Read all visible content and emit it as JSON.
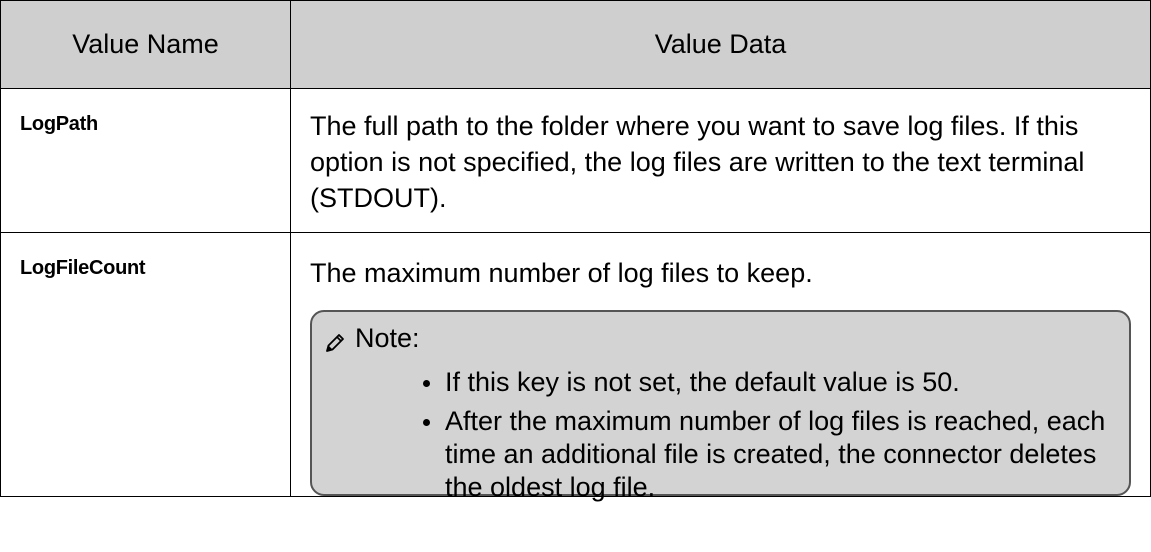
{
  "table": {
    "headers": {
      "name": "Value Name",
      "data": "Value Data"
    },
    "rows": [
      {
        "name": "LogPath",
        "data": "The full path to the folder where you want to save log files. If this option is not specified, the log files are written to the text terminal (STDOUT)."
      },
      {
        "name": "LogFileCount",
        "data": "The maximum number of log files to keep.",
        "note": {
          "icon": "pencil-icon",
          "label": "Note:",
          "items": [
            "If this key is not set, the default value is 50.",
            "After the maximum number of log files is reached, each time an additional file is created, the connector deletes the oldest log file."
          ]
        }
      }
    ]
  },
  "colors": {
    "header_bg": "#cfcfcf",
    "note_bg": "#d3d3d3",
    "border": "#000000"
  }
}
